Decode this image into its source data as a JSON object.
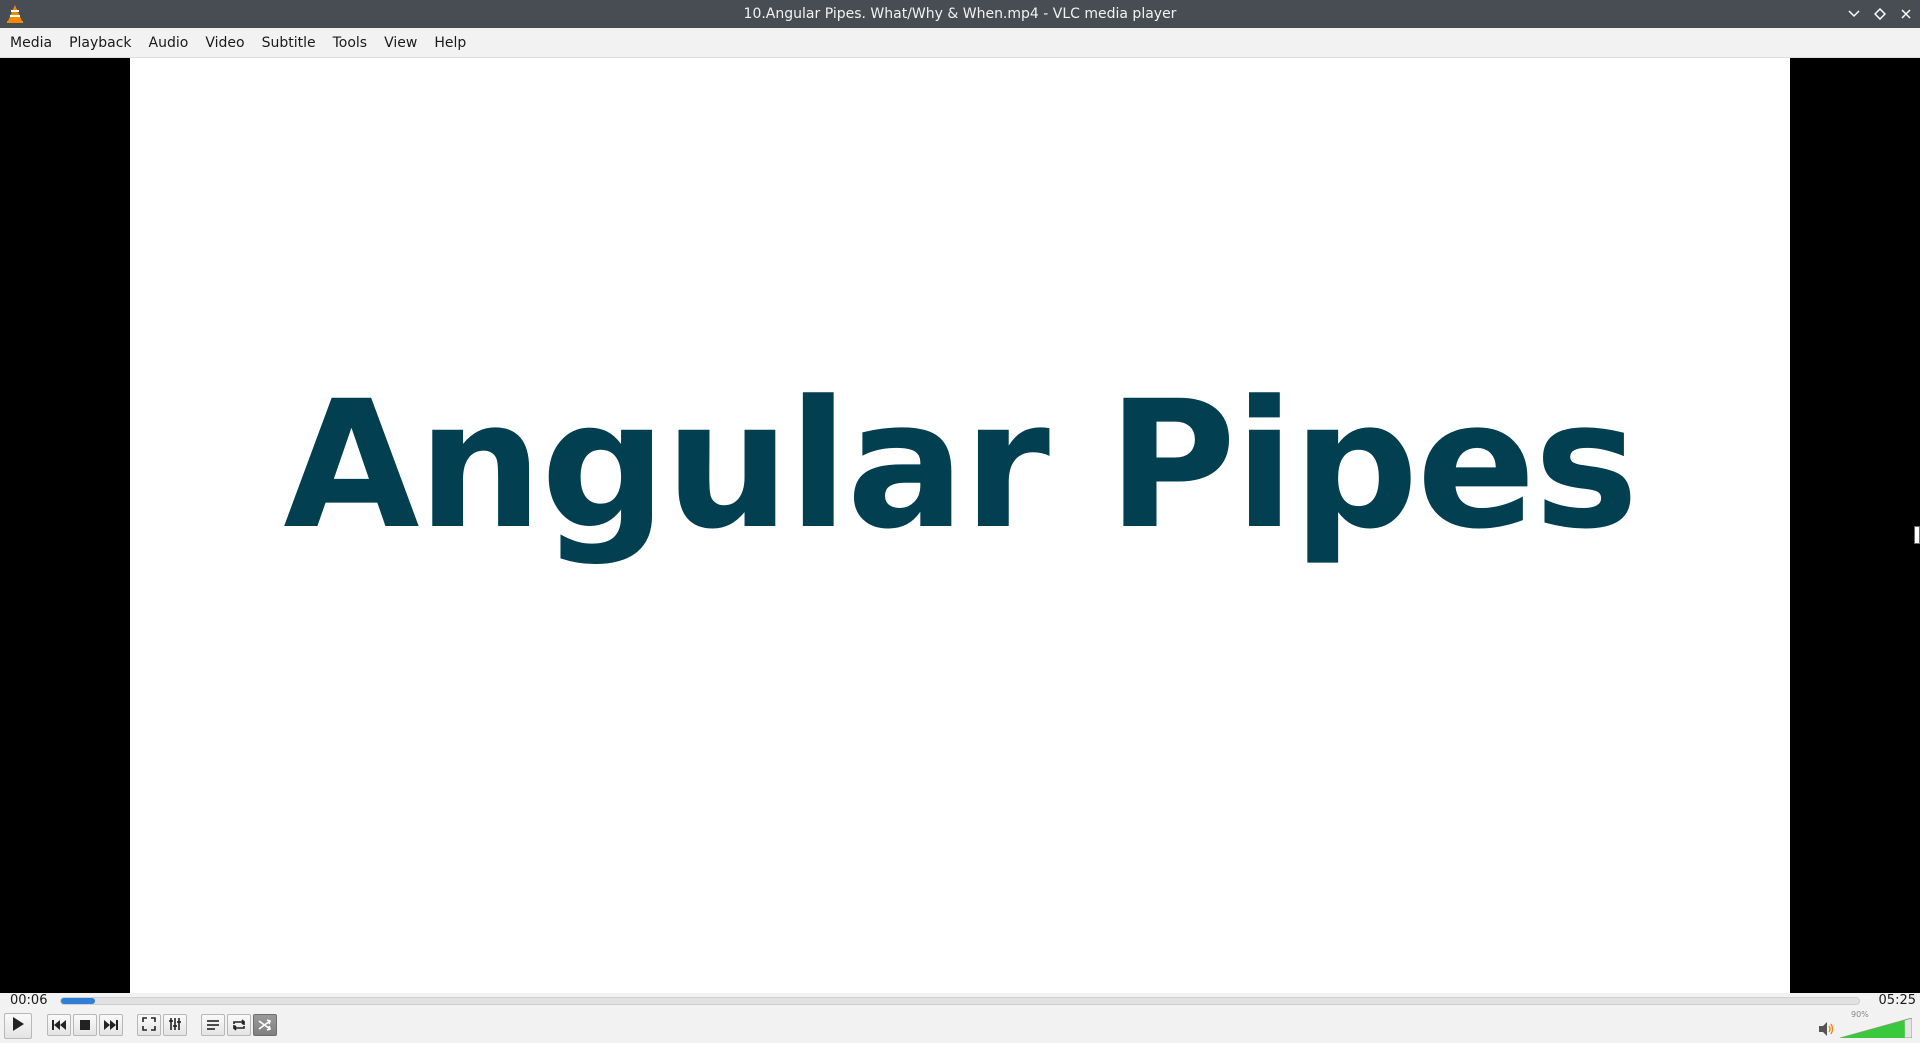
{
  "window": {
    "title": "10.Angular Pipes. What/Why & When.mp4 - VLC media player",
    "app_icon": "vlc-cone-icon"
  },
  "menu": {
    "items": [
      "Media",
      "Playback",
      "Audio",
      "Video",
      "Subtitle",
      "Tools",
      "View",
      "Help"
    ]
  },
  "video": {
    "frame_text": "Angular Pipes",
    "text_color": "#013f51"
  },
  "playback": {
    "elapsed": "00:06",
    "total": "05:25",
    "progress_fraction": 0.019
  },
  "volume": {
    "label": "90%",
    "level_fraction": 0.9
  },
  "colors": {
    "titlebar": "#474d52",
    "seek_fill": "#2f7fd6",
    "volume_fill": "#3cc83c"
  }
}
